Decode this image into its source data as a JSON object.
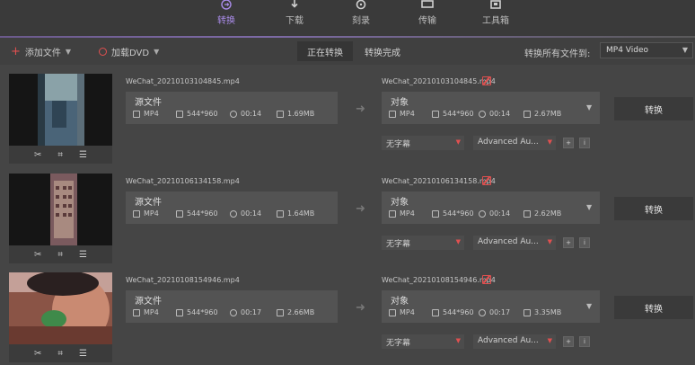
{
  "nav": [
    {
      "label": "转换",
      "icon": "convert-icon",
      "active": true
    },
    {
      "label": "下载",
      "icon": "download-icon",
      "active": false
    },
    {
      "label": "刻录",
      "icon": "burn-icon",
      "active": false
    },
    {
      "label": "传输",
      "icon": "transfer-icon",
      "active": false
    },
    {
      "label": "工具箱",
      "icon": "toolbox-icon",
      "active": false
    }
  ],
  "toolbar": {
    "add_files": "添加文件",
    "load_dvd": "加载DVD",
    "tab_converting": "正在转换",
    "tab_done": "转换完成",
    "convert_all_label": "转换所有文件到:",
    "format_value": "MP4 Video"
  },
  "colors": {
    "accent": "#a98be8",
    "red": "#e05050",
    "bg": "#454545"
  },
  "files": [
    {
      "source_name": "WeChat_20210103104845.mp4",
      "source_title": "源文件",
      "source": {
        "format": "MP4",
        "res": "544*960",
        "duration": "00:14",
        "size": "1.69MB"
      },
      "target_name": "WeChat_20210103104845.mp4",
      "target_title": "对象",
      "target": {
        "format": "MP4",
        "res": "544*960",
        "duration": "00:14",
        "size": "2.67MB"
      },
      "subtitle": "无字幕",
      "audio": "Advanced Au...",
      "convert": "转换"
    },
    {
      "source_name": "WeChat_20210106134158.mp4",
      "source_title": "源文件",
      "source": {
        "format": "MP4",
        "res": "544*960",
        "duration": "00:14",
        "size": "1.64MB"
      },
      "target_name": "WeChat_20210106134158.mp4",
      "target_title": "对象",
      "target": {
        "format": "MP4",
        "res": "544*960",
        "duration": "00:14",
        "size": "2.62MB"
      },
      "subtitle": "无字幕",
      "audio": "Advanced Au...",
      "convert": "转换"
    },
    {
      "source_name": "WeChat_20210108154946.mp4",
      "source_title": "源文件",
      "source": {
        "format": "MP4",
        "res": "544*960",
        "duration": "00:17",
        "size": "2.66MB"
      },
      "target_name": "WeChat_20210108154946.mp4",
      "target_title": "对象",
      "target": {
        "format": "MP4",
        "res": "544*960",
        "duration": "00:17",
        "size": "3.35MB"
      },
      "subtitle": "无字幕",
      "audio": "Advanced Au...",
      "convert": "转换"
    }
  ]
}
